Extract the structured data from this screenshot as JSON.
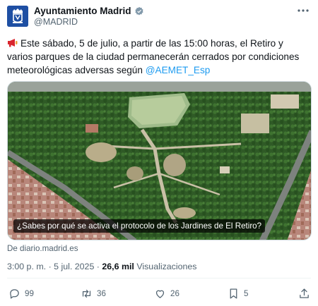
{
  "header": {
    "account_name": "Ayuntamiento Madrid",
    "handle": "@MADRID",
    "verified_icon": "verified-badge-icon",
    "more_icon": "more-options-icon"
  },
  "tweet": {
    "emoji": "megaphone-icon",
    "text": "Este sábado, 5 de julio, a partir de las 15:00 horas, el Retiro y varios parques de la ciudad permanecerán cerrados por condiciones meteorológicas adversas según ",
    "mention": "@AEMET_Esp"
  },
  "media": {
    "caption": "¿Sabes por qué se activa el protocolo de los Jardines de El Retiro?",
    "source": "De diario.madrid.es"
  },
  "meta": {
    "time": "3:00 p. m.",
    "separator": "·",
    "date": "5 jul. 2025",
    "views_separator": "·",
    "views_count": "26,6 mil",
    "views_label": "Visualizaciones"
  },
  "actions": {
    "replies": "99",
    "reposts": "36",
    "likes": "26",
    "bookmarks": "5"
  },
  "colors": {
    "accent": "#1d9bf0",
    "text": "#0f1419",
    "secondary": "#536471",
    "avatar": "#1e4fa3"
  }
}
